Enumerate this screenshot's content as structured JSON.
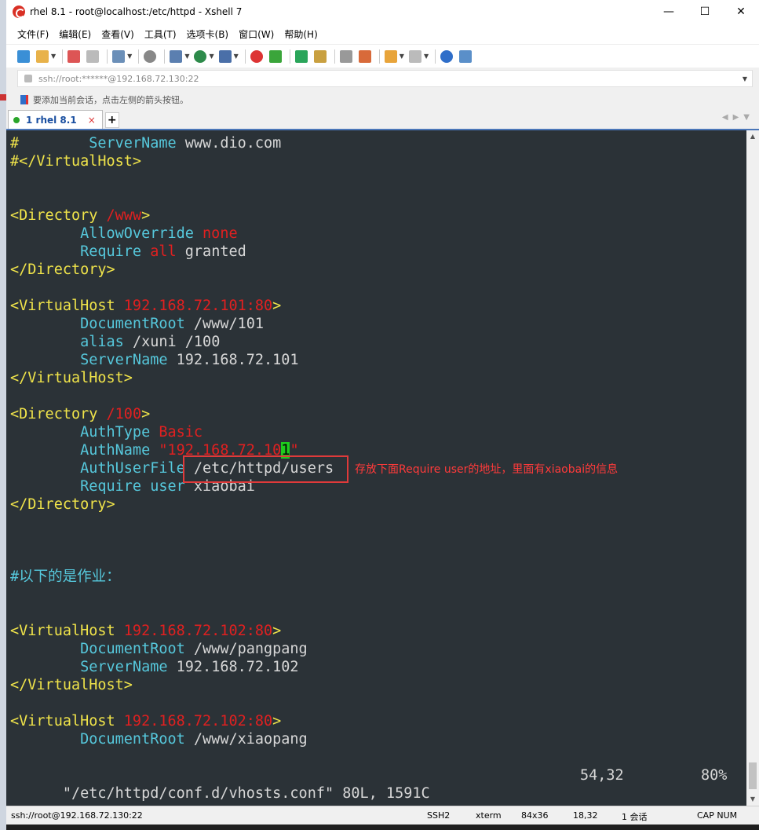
{
  "window": {
    "title": "rhel 8.1 - root@localhost:/etc/httpd - Xshell 7",
    "minimize": "—",
    "maximize": "☐",
    "close": "✕"
  },
  "menu": [
    "文件(F)",
    "编辑(E)",
    "查看(V)",
    "工具(T)",
    "选项卡(B)",
    "窗口(W)",
    "帮助(H)"
  ],
  "address": {
    "value": "ssh://root:******@192.168.72.130:22"
  },
  "hint": "要添加当前会话，点击左侧的箭头按钮。",
  "tab": {
    "label": "1 rhel 8.1",
    "close": "×",
    "new": "+"
  },
  "terminal": {
    "lines": [
      [
        [
          "c-y",
          "#"
        ],
        [
          "c-w",
          "        "
        ],
        [
          "c-c",
          "ServerName"
        ],
        [
          "c-w",
          " www.dio.com"
        ]
      ],
      [
        [
          "c-y",
          "#</VirtualHost>"
        ]
      ],
      [],
      [],
      [
        [
          "c-y",
          "<Directory"
        ],
        [
          "c-w",
          " "
        ],
        [
          "c-r",
          "/www"
        ],
        [
          "c-y",
          ">"
        ]
      ],
      [
        [
          "c-w",
          "        "
        ],
        [
          "c-c",
          "AllowOverride"
        ],
        [
          "c-w",
          " "
        ],
        [
          "c-r",
          "none"
        ]
      ],
      [
        [
          "c-w",
          "        "
        ],
        [
          "c-c",
          "Require"
        ],
        [
          "c-w",
          " "
        ],
        [
          "c-r",
          "all"
        ],
        [
          "c-w",
          " granted"
        ]
      ],
      [
        [
          "c-y",
          "</Directory>"
        ]
      ],
      [],
      [
        [
          "c-y",
          "<VirtualHost"
        ],
        [
          "c-w",
          " "
        ],
        [
          "c-r",
          "192.168.72.101:80"
        ],
        [
          "c-y",
          ">"
        ]
      ],
      [
        [
          "c-w",
          "        "
        ],
        [
          "c-c",
          "DocumentRoot"
        ],
        [
          "c-w",
          " /www/101"
        ]
      ],
      [
        [
          "c-w",
          "        "
        ],
        [
          "c-c",
          "alias"
        ],
        [
          "c-w",
          " /xuni /100"
        ]
      ],
      [
        [
          "c-w",
          "        "
        ],
        [
          "c-c",
          "ServerName"
        ],
        [
          "c-w",
          " 192.168.72.101"
        ]
      ],
      [
        [
          "c-y",
          "</VirtualHost>"
        ]
      ],
      [],
      [
        [
          "c-y",
          "<Directory"
        ],
        [
          "c-w",
          " "
        ],
        [
          "c-r",
          "/100"
        ],
        [
          "c-y",
          ">"
        ]
      ],
      [
        [
          "c-w",
          "        "
        ],
        [
          "c-c",
          "AuthType"
        ],
        [
          "c-w",
          " "
        ],
        [
          "c-r",
          "Basic"
        ]
      ],
      [
        [
          "c-w",
          "        "
        ],
        [
          "c-c",
          "AuthName"
        ],
        [
          "c-w",
          " "
        ],
        [
          "c-r",
          "\"192.168.72.10"
        ],
        [
          "cursor",
          "1"
        ],
        [
          "c-r",
          "\""
        ]
      ],
      [
        [
          "c-w",
          "        "
        ],
        [
          "c-c",
          "AuthUserFile"
        ],
        [
          "c-w",
          " /etc/httpd/users"
        ]
      ],
      [
        [
          "c-w",
          "        "
        ],
        [
          "c-c",
          "Require user"
        ],
        [
          "c-w",
          " xiaobai"
        ]
      ],
      [
        [
          "c-y",
          "</Directory>"
        ]
      ],
      [],
      [],
      [],
      [
        [
          "c-c",
          "#以下的是作业："
        ]
      ],
      [],
      [],
      [
        [
          "c-y",
          "<VirtualHost"
        ],
        [
          "c-w",
          " "
        ],
        [
          "c-r",
          "192.168.72.102:80"
        ],
        [
          "c-y",
          ">"
        ]
      ],
      [
        [
          "c-w",
          "        "
        ],
        [
          "c-c",
          "DocumentRoot"
        ],
        [
          "c-w",
          " /www/pangpang"
        ]
      ],
      [
        [
          "c-w",
          "        "
        ],
        [
          "c-c",
          "ServerName"
        ],
        [
          "c-w",
          " 192.168.72.102"
        ]
      ],
      [
        [
          "c-y",
          "</VirtualHost>"
        ]
      ],
      [],
      [
        [
          "c-y",
          "<VirtualHost"
        ],
        [
          "c-w",
          " "
        ],
        [
          "c-r",
          "192.168.72.102:80"
        ],
        [
          "c-y",
          ">"
        ]
      ],
      [
        [
          "c-w",
          "        "
        ],
        [
          "c-c",
          "DocumentRoot"
        ],
        [
          "c-w",
          " /www/xiaopang"
        ]
      ]
    ],
    "status_file": "\"/etc/httpd/conf.d/vhosts.conf\" 80L, 1591C",
    "status_pos": "54,32",
    "status_pct": "80%"
  },
  "annotation": "存放下面Require user的地址，里面有xiaobai的信息",
  "statusbar": {
    "session": "ssh://root@192.168.72.130:22",
    "protocol": "SSH2",
    "term": "xterm",
    "size": "84x36",
    "cursor": "18,32",
    "sessions": "1 会话",
    "caps": "CAP NUM"
  },
  "colors": {
    "terminal_bg": "#2b3237",
    "keyword_yellow": "#f0e44a",
    "directive_cyan": "#56c8dc",
    "value_red": "#e02020",
    "annotation_red": "#e03a3a",
    "cursor_green": "#1ecc1e"
  }
}
